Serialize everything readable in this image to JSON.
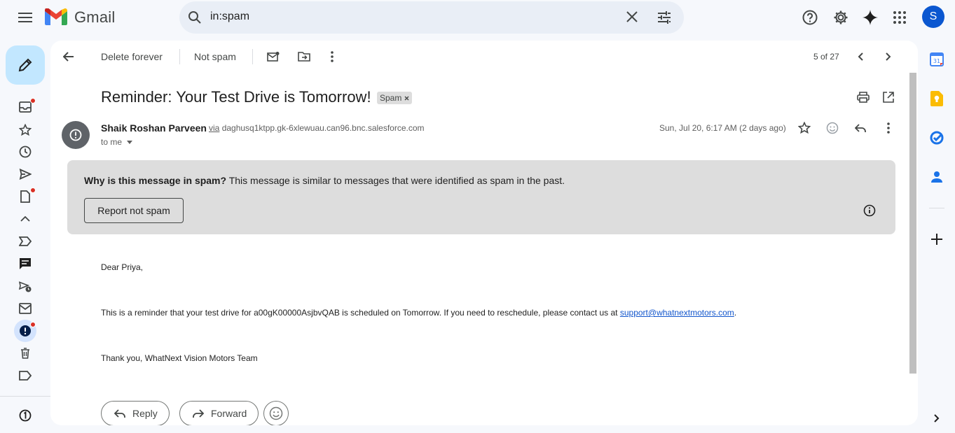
{
  "header": {
    "brand": "Gmail",
    "search_value": "in:spam",
    "avatar_letter": "S",
    "icons": [
      "menu-icon",
      "search-icon",
      "clear-search-icon",
      "search-options-icon",
      "help-icon",
      "settings-icon",
      "gemini-icon",
      "apps-icon"
    ]
  },
  "rail": {
    "items": [
      "inbox-icon",
      "starred-icon",
      "snoozed-icon",
      "sent-icon",
      "drafts-icon",
      "less-icon",
      "important-icon",
      "chats-icon",
      "scheduled-icon",
      "all-mail-icon",
      "spam-icon",
      "trash-icon",
      "label-icon"
    ],
    "badge_color": "#d93025"
  },
  "toolbar": {
    "delete_label": "Delete forever",
    "not_spam_label": "Not spam",
    "pagination": "5 of 27"
  },
  "message": {
    "subject": "Reminder: Your Test Drive is Tomorrow!",
    "badge": "Spam",
    "sender_name": "Shaik Roshan Parveen",
    "via_label": "via",
    "via_domain": "daghusq1ktpp.gk-6xlewuau.can96.bnc.salesforce.com",
    "to_label": "to me",
    "date": "Sun, Jul 20, 6:17 AM (2 days ago)"
  },
  "spam_notice": {
    "question": "Why is this message in spam?",
    "explanation": "This message is similar to messages that were identified as spam in the past.",
    "report_button": "Report not spam"
  },
  "body": {
    "greeting": "Dear Priya,",
    "reminder_text": "This is a reminder that your test drive for a00gK00000AsjbvQAB is scheduled on Tomorrow. If you need to reschedule, please contact us at ",
    "email_link": "support@whatnextmotors.com",
    "period": ".",
    "signoff": "Thank you,  WhatNext Vision Motors Team"
  },
  "actions": {
    "reply_label": "Reply",
    "forward_label": "Forward"
  },
  "colors": {
    "accent": "#0b57d0",
    "compose_bg": "#c2e7ff",
    "spam_box_bg": "#dddddd",
    "link": "#1155cc"
  }
}
